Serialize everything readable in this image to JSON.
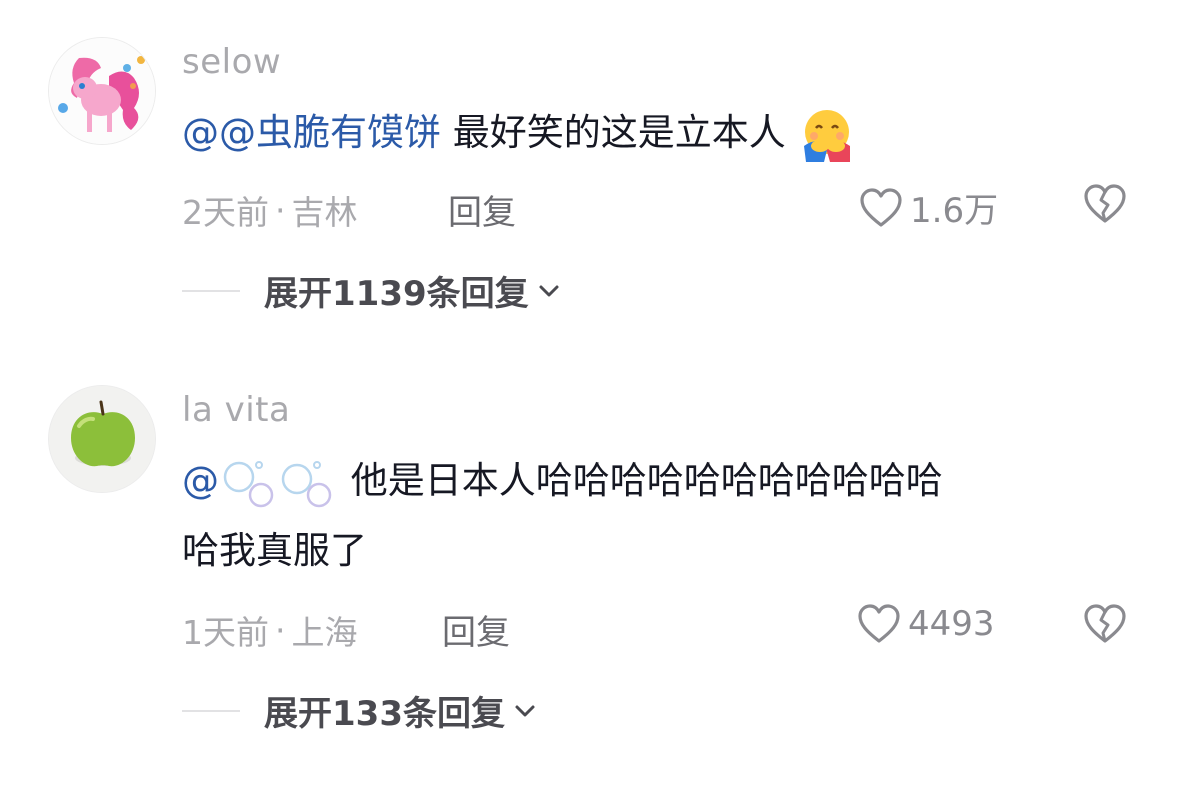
{
  "comments": [
    {
      "username": "selow",
      "mention_prefix": "@",
      "mention": "@虫脆有馍饼",
      "text": " 最好笑的这是立本人",
      "emoji": "hug-emoji",
      "time": "2天前",
      "location": "吉林",
      "reply_label": "回复",
      "likes": "1.6万",
      "expand_label": "展开1139条回复"
    },
    {
      "username": "la vita",
      "mention": "@",
      "text_line1": " 他是日本人哈哈哈哈哈哈哈哈哈哈哈",
      "text_line2": "哈我真服了",
      "time": "1天前",
      "location": "上海",
      "reply_label": "回复",
      "likes": "4493",
      "expand_label": "展开133条回复"
    }
  ],
  "meta_separator": "·"
}
